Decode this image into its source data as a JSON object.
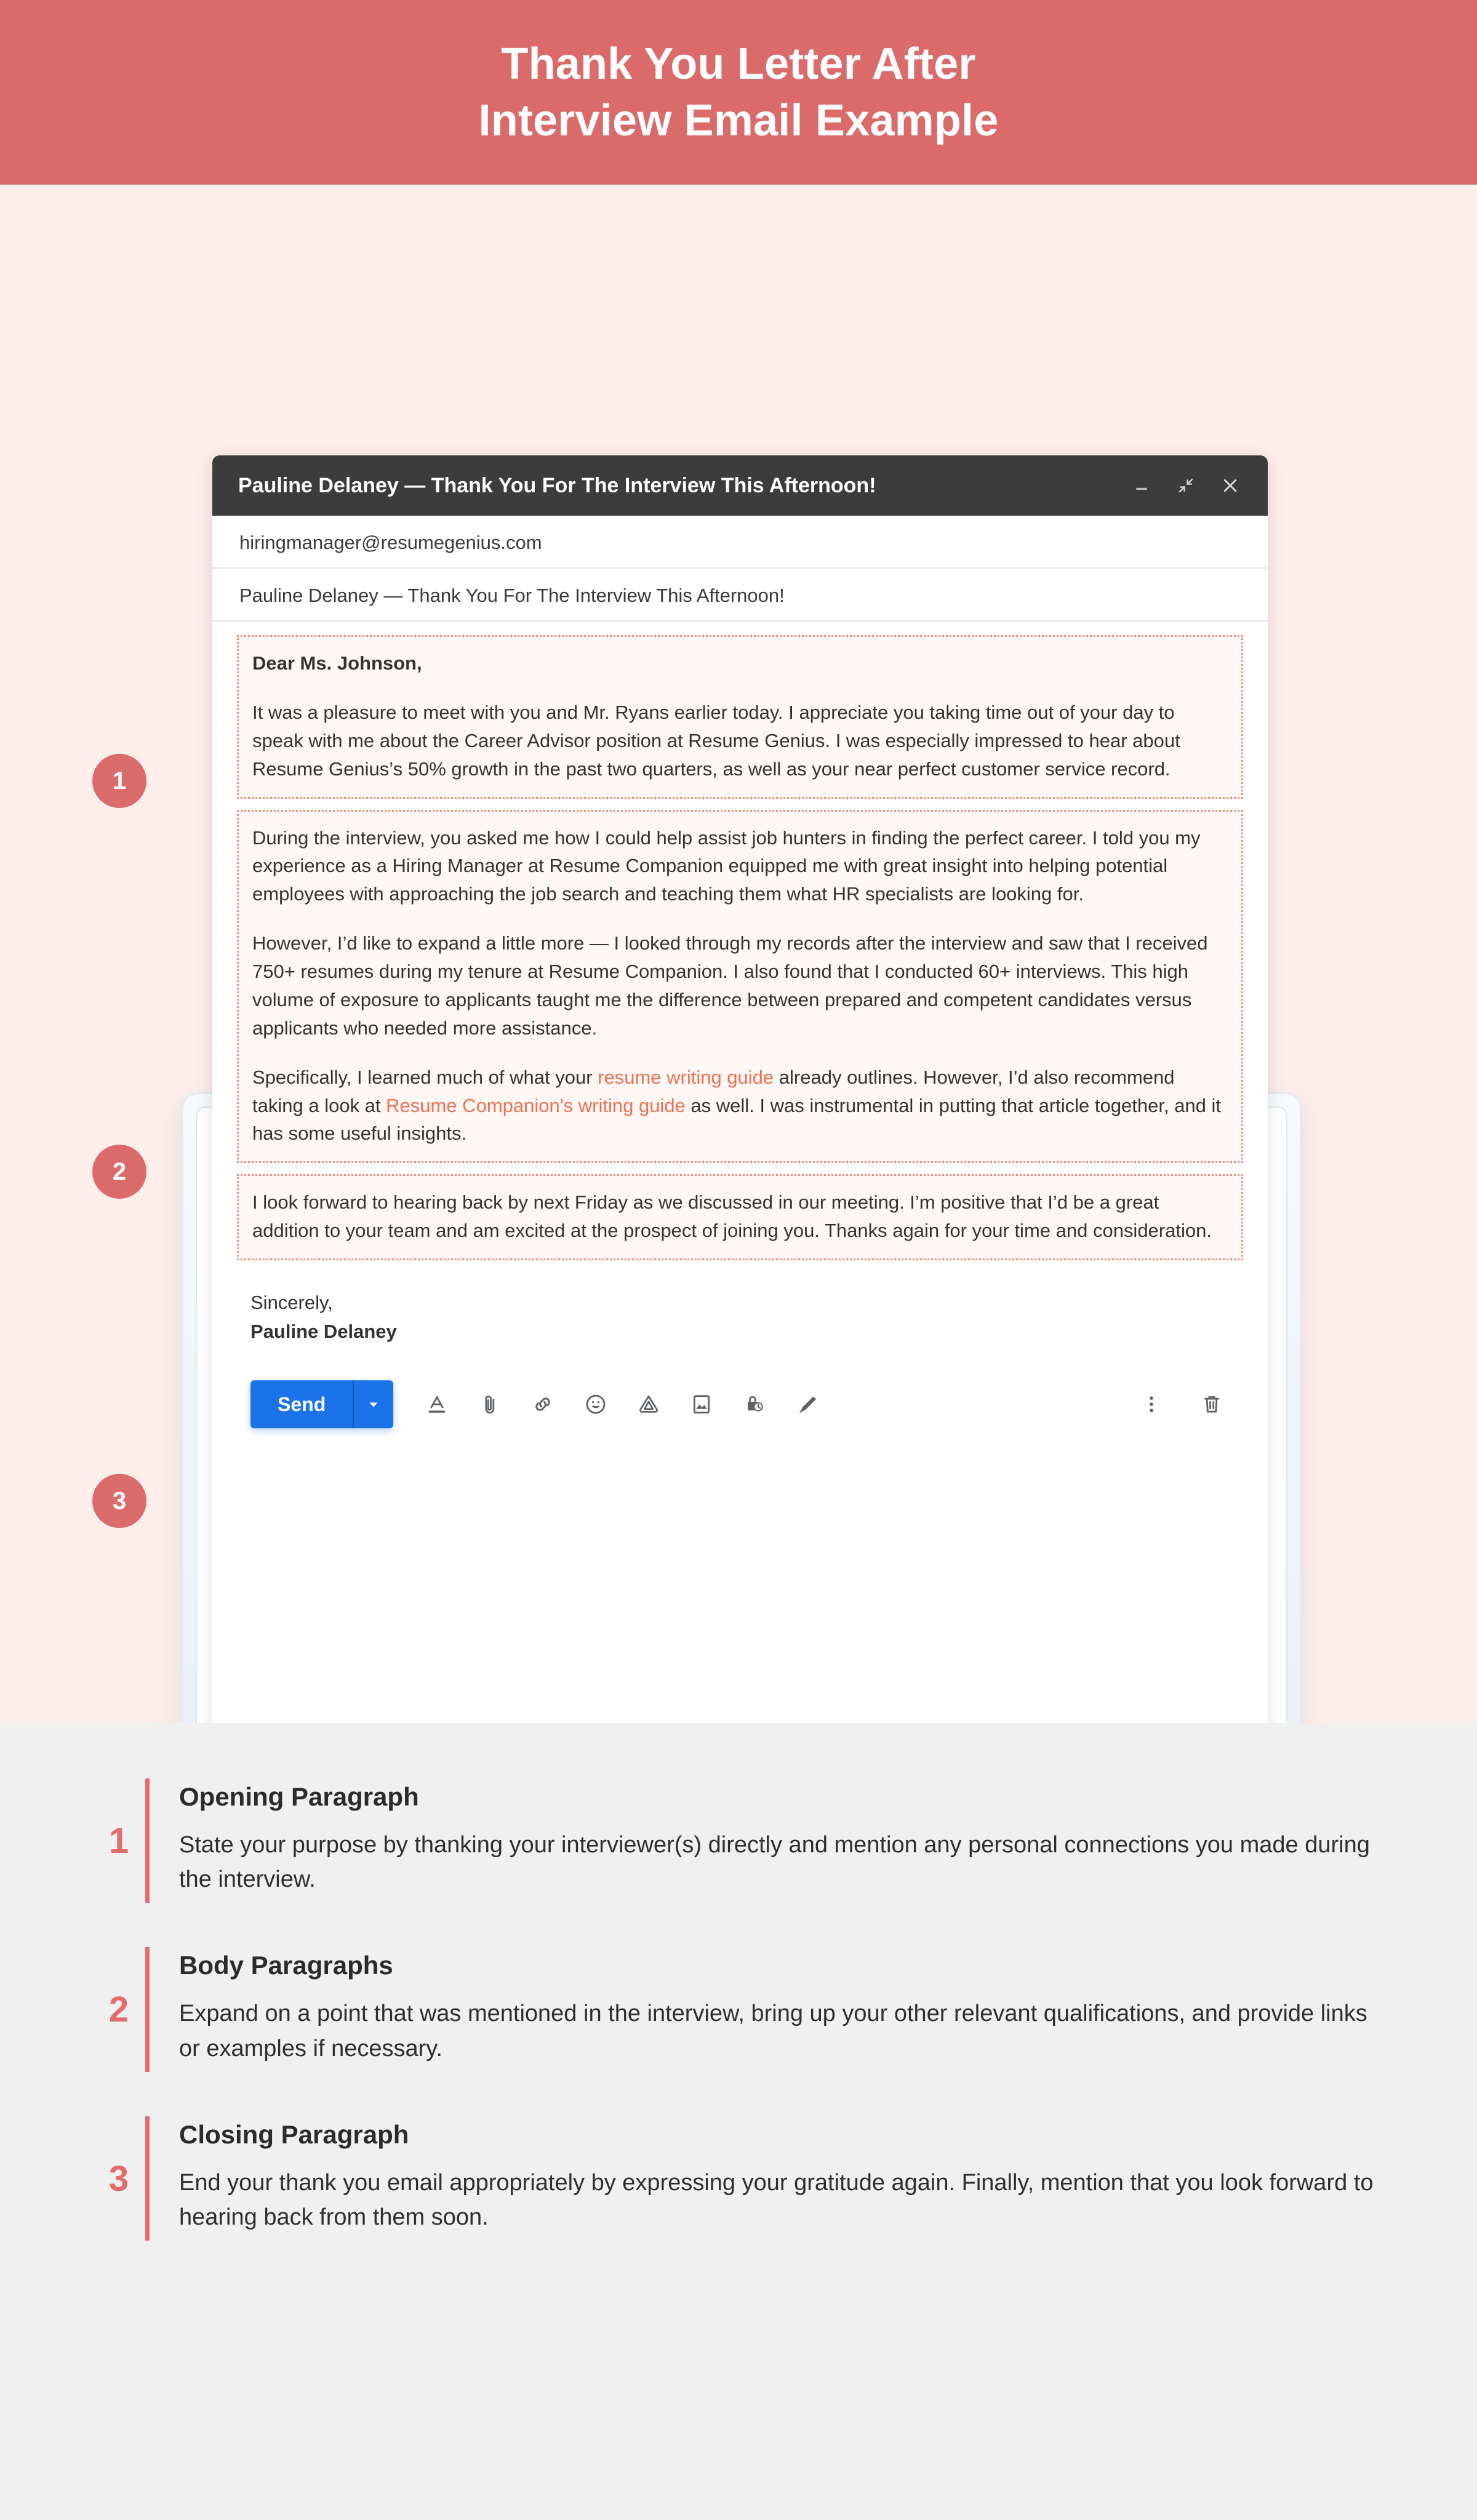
{
  "banner": {
    "line1": "Thank You Letter After",
    "line2": "Interview Email Example",
    "bg_color": "#DB6B6B"
  },
  "colors": {
    "accent_red": "#DB6B6B",
    "page_pink": "#FDEEEC",
    "link_orange": "#F07050",
    "dotted_border": "#EE8E78",
    "send_blue": "#1A73E8",
    "titlebar_dark": "#3C3C3C",
    "explain_bg": "#F0F0F0"
  },
  "mail": {
    "window_title": "Pauline Delaney — Thank You For The Interview This Afternoon!",
    "window_controls": [
      {
        "name": "minimize-icon",
        "glyph": "minimize"
      },
      {
        "name": "fullscreen-icon",
        "glyph": "fullscreen"
      },
      {
        "name": "close-icon",
        "glyph": "close"
      }
    ],
    "to_field": "hiringmanager@resumegenius.com",
    "subject_field": "Pauline Delaney — Thank You For The Interview This Afternoon!",
    "salutation": "Dear Ms. Johnson,",
    "paragraph1": "It was a pleasure to meet with you and Mr. Ryans earlier today. I appreciate you taking time out of your day to speak with me about the Career Advisor position at Resume Genius. I was especially impressed to hear about Resume Genius’s 50% growth in the past two quarters, as well as your near perfect customer service record.",
    "paragraph2a": "During the interview, you asked me how I could help assist job hunters in finding the perfect career. I told you my experience as a Hiring Manager at Resume Companion equipped me with great insight into helping potential employees with approaching the job search and teaching them what HR specialists are looking for.",
    "paragraph2b": "However, I’d like to expand a little more — I looked through my records after the interview and saw that I received 750+ resumes during my tenure at Resume Companion. I also found that I conducted 60+ interviews. This high volume of exposure to applicants taught me the difference between prepared and competent candidates versus applicants who needed more assistance.",
    "paragraph2c_pre": "Specifically, I learned much of what your ",
    "paragraph2c_link1": "resume writing guide",
    "paragraph2c_mid": " already outlines. However, I’d also recommend taking a look at ",
    "paragraph2c_link2": "Resume Companion's writing guide",
    "paragraph2c_post": " as well. I was instrumental in putting that article together, and it has some useful insights.",
    "paragraph3": "I look forward to hearing back by next Friday as we discussed in our meeting. I’m positive that I’d be a great addition to your team and am excited at the prospect of joining you. Thanks again for your time and consideration.",
    "signoff_closing": "Sincerely,",
    "signoff_name": "Pauline Delaney",
    "toolbar": {
      "send_label": "Send",
      "send_caret": "▾",
      "icons": [
        {
          "name": "formatting-options-icon"
        },
        {
          "name": "attach-file-icon"
        },
        {
          "name": "insert-link-icon"
        },
        {
          "name": "insert-emoji-icon"
        },
        {
          "name": "insert-drive-file-icon"
        },
        {
          "name": "insert-photo-icon"
        },
        {
          "name": "confidential-mode-icon"
        },
        {
          "name": "insert-signature-icon"
        }
      ],
      "more_options_icon": "more-options-icon",
      "discard_icon": "discard-draft-icon"
    }
  },
  "callout_badges": [
    "1",
    "2",
    "3"
  ],
  "explanations": [
    {
      "number": "1",
      "title": "Opening Paragraph",
      "description": "State your purpose by thanking your interviewer(s) directly and mention any personal connections you made during the interview."
    },
    {
      "number": "2",
      "title": "Body Paragraphs",
      "description": "Expand on a point that was mentioned in the interview, bring up your other relevant qualifications, and provide links or examples if necessary."
    },
    {
      "number": "3",
      "title": "Closing Paragraph",
      "description": "End your thank you email appropriately by expressing your gratitude again. Finally, mention that you look forward to hearing back from them soon."
    }
  ]
}
